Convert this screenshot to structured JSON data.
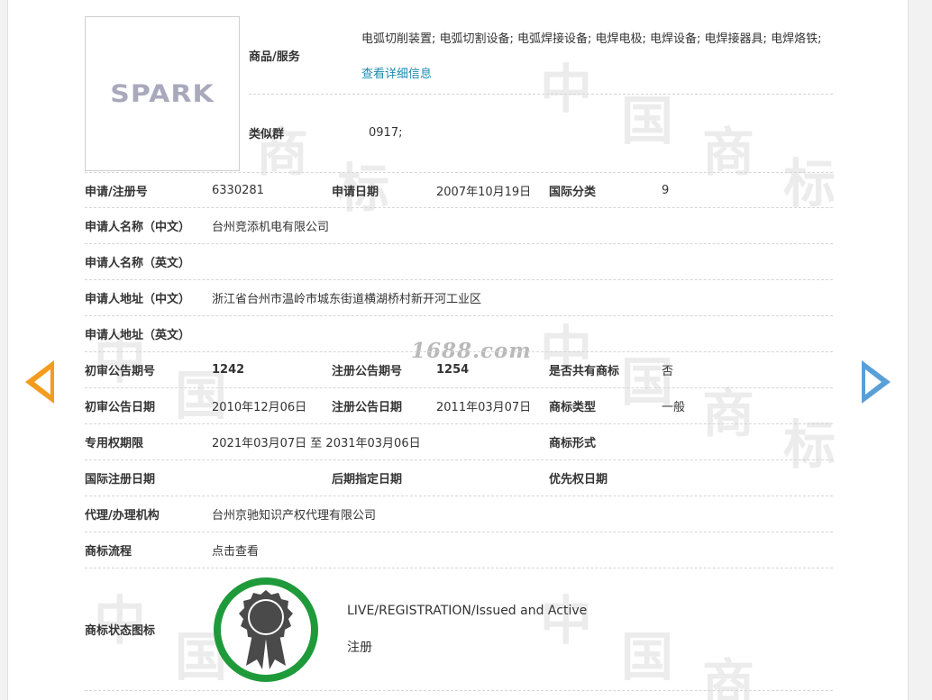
{
  "watermark": {
    "site": "1688.com"
  },
  "logo": {
    "text": "SPARK"
  },
  "goods": {
    "label": "商品/服务",
    "value": "电弧切削装置; 电弧切割设备; 电弧焊接设备; 电焊电极; 电焊设备; 电焊接器具; 电焊烙铁;",
    "link": "查看详细信息"
  },
  "similar_group": {
    "label": "类似群",
    "value": "0917;"
  },
  "rows": {
    "reg_no_label": "申请/注册号",
    "reg_no": "6330281",
    "apply_date_label": "申请日期",
    "apply_date": "2007年10月19日",
    "intl_class_label": "国际分类",
    "intl_class": "9",
    "applicant_cn_label": "申请人名称（中文）",
    "applicant_cn": "台州竞添机电有限公司",
    "applicant_en_label": "申请人名称（英文）",
    "applicant_en": "",
    "address_cn_label": "申请人地址（中文）",
    "address_cn": "浙江省台州市温岭市城东街道横湖桥村新开河工业区",
    "address_en_label": "申请人地址（英文）",
    "address_en": "",
    "prelim_pub_no_label": "初审公告期号",
    "prelim_pub_no": "1242",
    "reg_pub_no_label": "注册公告期号",
    "reg_pub_no": "1254",
    "shared_label": "是否共有商标",
    "shared": "否",
    "prelim_pub_date_label": "初审公告日期",
    "prelim_pub_date": "2010年12月06日",
    "reg_pub_date_label": "注册公告日期",
    "reg_pub_date": "2011年03月07日",
    "tm_type_label": "商标类型",
    "tm_type": "一般",
    "exclusive_label": "专用权期限",
    "exclusive": "2021年03月07日 至 2031年03月06日",
    "tm_form_label": "商标形式",
    "tm_form": "",
    "intl_reg_date_label": "国际注册日期",
    "intl_reg_date": "",
    "later_date_label": "后期指定日期",
    "later_date": "",
    "priority_date_label": "优先权日期",
    "priority_date": "",
    "agent_label": "代理/办理机构",
    "agent": "台州京驰知识产权代理有限公司",
    "process_label": "商标流程",
    "process_link": "点击查看",
    "status_label": "商标状态图标",
    "status_en": "LIVE/REGISTRATION/Issued and Active",
    "status_cn": "注册"
  },
  "icons": {
    "prev": "arrow-left-icon",
    "next": "arrow-right-icon",
    "seal": "registered-seal-icon"
  },
  "colors": {
    "link": "#1c8bb0",
    "prev_arrow": "#f39c1d",
    "next_arrow": "#5aa0d8",
    "seal_ring": "#1f9a3a",
    "seal_fill": "#4a4a4a"
  }
}
